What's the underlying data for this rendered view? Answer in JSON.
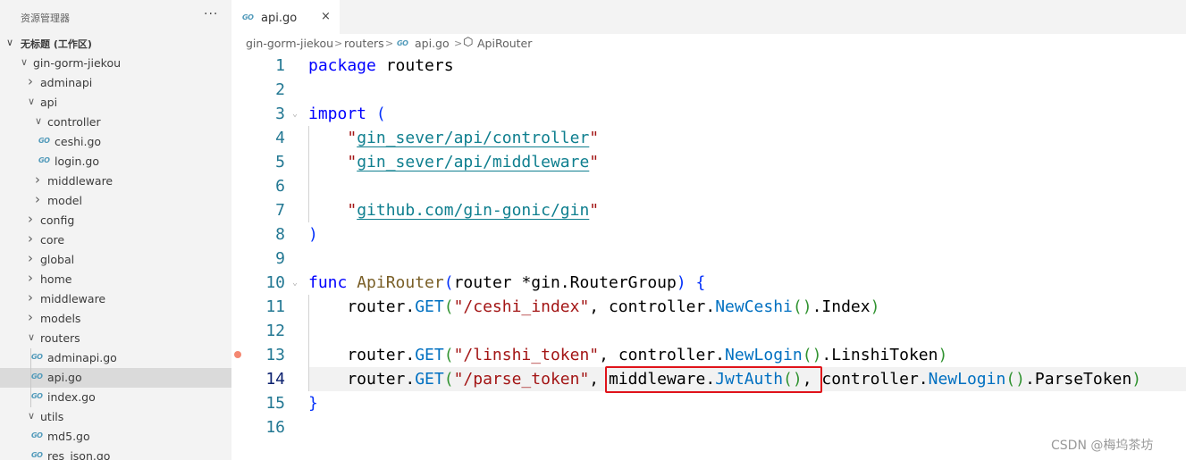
{
  "sidebar": {
    "title": "资源管理器",
    "more": "···",
    "workspace": "无标题 (工作区)",
    "tree": [
      {
        "label": "gin-gorm-jiekou",
        "type": "folder",
        "open": true,
        "depth": 1
      },
      {
        "label": "adminapi",
        "type": "folder",
        "open": false,
        "depth": 2
      },
      {
        "label": "api",
        "type": "folder",
        "open": true,
        "depth": 2
      },
      {
        "label": "controller",
        "type": "folder",
        "open": true,
        "depth": 3
      },
      {
        "label": "ceshi.go",
        "type": "file",
        "depth": 4
      },
      {
        "label": "login.go",
        "type": "file",
        "depth": 4
      },
      {
        "label": "middleware",
        "type": "folder",
        "open": false,
        "depth": 3
      },
      {
        "label": "model",
        "type": "folder",
        "open": false,
        "depth": 3
      },
      {
        "label": "config",
        "type": "folder",
        "open": false,
        "depth": 2
      },
      {
        "label": "core",
        "type": "folder",
        "open": false,
        "depth": 2
      },
      {
        "label": "global",
        "type": "folder",
        "open": false,
        "depth": 2
      },
      {
        "label": "home",
        "type": "folder",
        "open": false,
        "depth": 2
      },
      {
        "label": "middleware",
        "type": "folder",
        "open": false,
        "depth": 2
      },
      {
        "label": "models",
        "type": "folder",
        "open": false,
        "depth": 2
      },
      {
        "label": "routers",
        "type": "folder",
        "open": true,
        "depth": 2
      },
      {
        "label": "adminapi.go",
        "type": "file",
        "depth": 3
      },
      {
        "label": "api.go",
        "type": "file",
        "depth": 3,
        "selected": true
      },
      {
        "label": "index.go",
        "type": "file",
        "depth": 3
      },
      {
        "label": "utils",
        "type": "folder",
        "open": true,
        "depth": 2
      },
      {
        "label": "md5.go",
        "type": "file",
        "depth": 3
      },
      {
        "label": "res_json.go",
        "type": "file",
        "depth": 3
      }
    ]
  },
  "tab": {
    "icon": "go-file-icon",
    "label": "api.go",
    "close": "×"
  },
  "go_badge": "GO",
  "breadcrumb": {
    "items": [
      "gin-gorm-jiekou",
      "routers",
      "api.go",
      "ApiRouter"
    ],
    "separator": ">"
  },
  "editor": {
    "line_numbers": [
      "1",
      "2",
      "3",
      "4",
      "5",
      "6",
      "7",
      "8",
      "9",
      "10",
      "11",
      "12",
      "13",
      "14",
      "15",
      "16"
    ],
    "current_line": 14,
    "breakpoint_line": 13,
    "lines": [
      [
        {
          "t": "package",
          "c": "kw2"
        },
        {
          "t": " routers",
          "c": "pu"
        }
      ],
      [],
      [
        {
          "t": "import",
          "c": "kw2"
        },
        {
          "t": " ",
          "c": "pu"
        },
        {
          "t": "(",
          "c": "br"
        }
      ],
      [
        {
          "t": "    ",
          "c": "pu"
        },
        {
          "t": "\"",
          "c": "st"
        },
        {
          "t": "gin_sever/api/controller",
          "c": "imp"
        },
        {
          "t": "\"",
          "c": "st"
        }
      ],
      [
        {
          "t": "    ",
          "c": "pu"
        },
        {
          "t": "\"",
          "c": "st"
        },
        {
          "t": "gin_sever/api/middleware",
          "c": "imp"
        },
        {
          "t": "\"",
          "c": "st"
        }
      ],
      [],
      [
        {
          "t": "    ",
          "c": "pu"
        },
        {
          "t": "\"",
          "c": "st"
        },
        {
          "t": "github.com/gin-gonic/gin",
          "c": "imp"
        },
        {
          "t": "\"",
          "c": "st"
        }
      ],
      [
        {
          "t": ")",
          "c": "br"
        }
      ],
      [],
      [
        {
          "t": "func",
          "c": "kw2"
        },
        {
          "t": " ",
          "c": "pu"
        },
        {
          "t": "ApiRouter",
          "c": "kw"
        },
        {
          "t": "(",
          "c": "br"
        },
        {
          "t": "router *gin.RouterGroup",
          "c": "pu"
        },
        {
          "t": ")",
          "c": "br"
        },
        {
          "t": " ",
          "c": "pu"
        },
        {
          "t": "{",
          "c": "br"
        }
      ],
      [
        {
          "t": "    router.",
          "c": "pu"
        },
        {
          "t": "GET",
          "c": "fn2"
        },
        {
          "t": "(",
          "c": "br2"
        },
        {
          "t": "\"/ceshi_index\"",
          "c": "st"
        },
        {
          "t": ", controller.",
          "c": "pu"
        },
        {
          "t": "NewCeshi",
          "c": "fn2"
        },
        {
          "t": "()",
          "c": "br2"
        },
        {
          "t": ".Index",
          "c": "pu"
        },
        {
          "t": ")",
          "c": "br2"
        }
      ],
      [],
      [
        {
          "t": "    router.",
          "c": "pu"
        },
        {
          "t": "GET",
          "c": "fn2"
        },
        {
          "t": "(",
          "c": "br2"
        },
        {
          "t": "\"/linshi_token\"",
          "c": "st"
        },
        {
          "t": ", controller.",
          "c": "pu"
        },
        {
          "t": "NewLogin",
          "c": "fn2"
        },
        {
          "t": "()",
          "c": "br2"
        },
        {
          "t": ".LinshiToken",
          "c": "pu"
        },
        {
          "t": ")",
          "c": "br2"
        }
      ],
      [
        {
          "t": "    router.",
          "c": "pu"
        },
        {
          "t": "GET",
          "c": "fn2"
        },
        {
          "t": "(",
          "c": "br2"
        },
        {
          "t": "\"/parse_token\"",
          "c": "st"
        },
        {
          "t": ", middleware.",
          "c": "pu"
        },
        {
          "t": "JwtAuth",
          "c": "fn2"
        },
        {
          "t": "()",
          "c": "br2"
        },
        {
          "t": ", controller.",
          "c": "pu"
        },
        {
          "t": "NewLogin",
          "c": "fn2"
        },
        {
          "t": "()",
          "c": "br2"
        },
        {
          "t": ".ParseToken",
          "c": "pu"
        },
        {
          "t": ")",
          "c": "br2"
        }
      ],
      [
        {
          "t": "}",
          "c": "br"
        }
      ],
      []
    ]
  },
  "watermark": "CSDN @梅坞茶坊"
}
